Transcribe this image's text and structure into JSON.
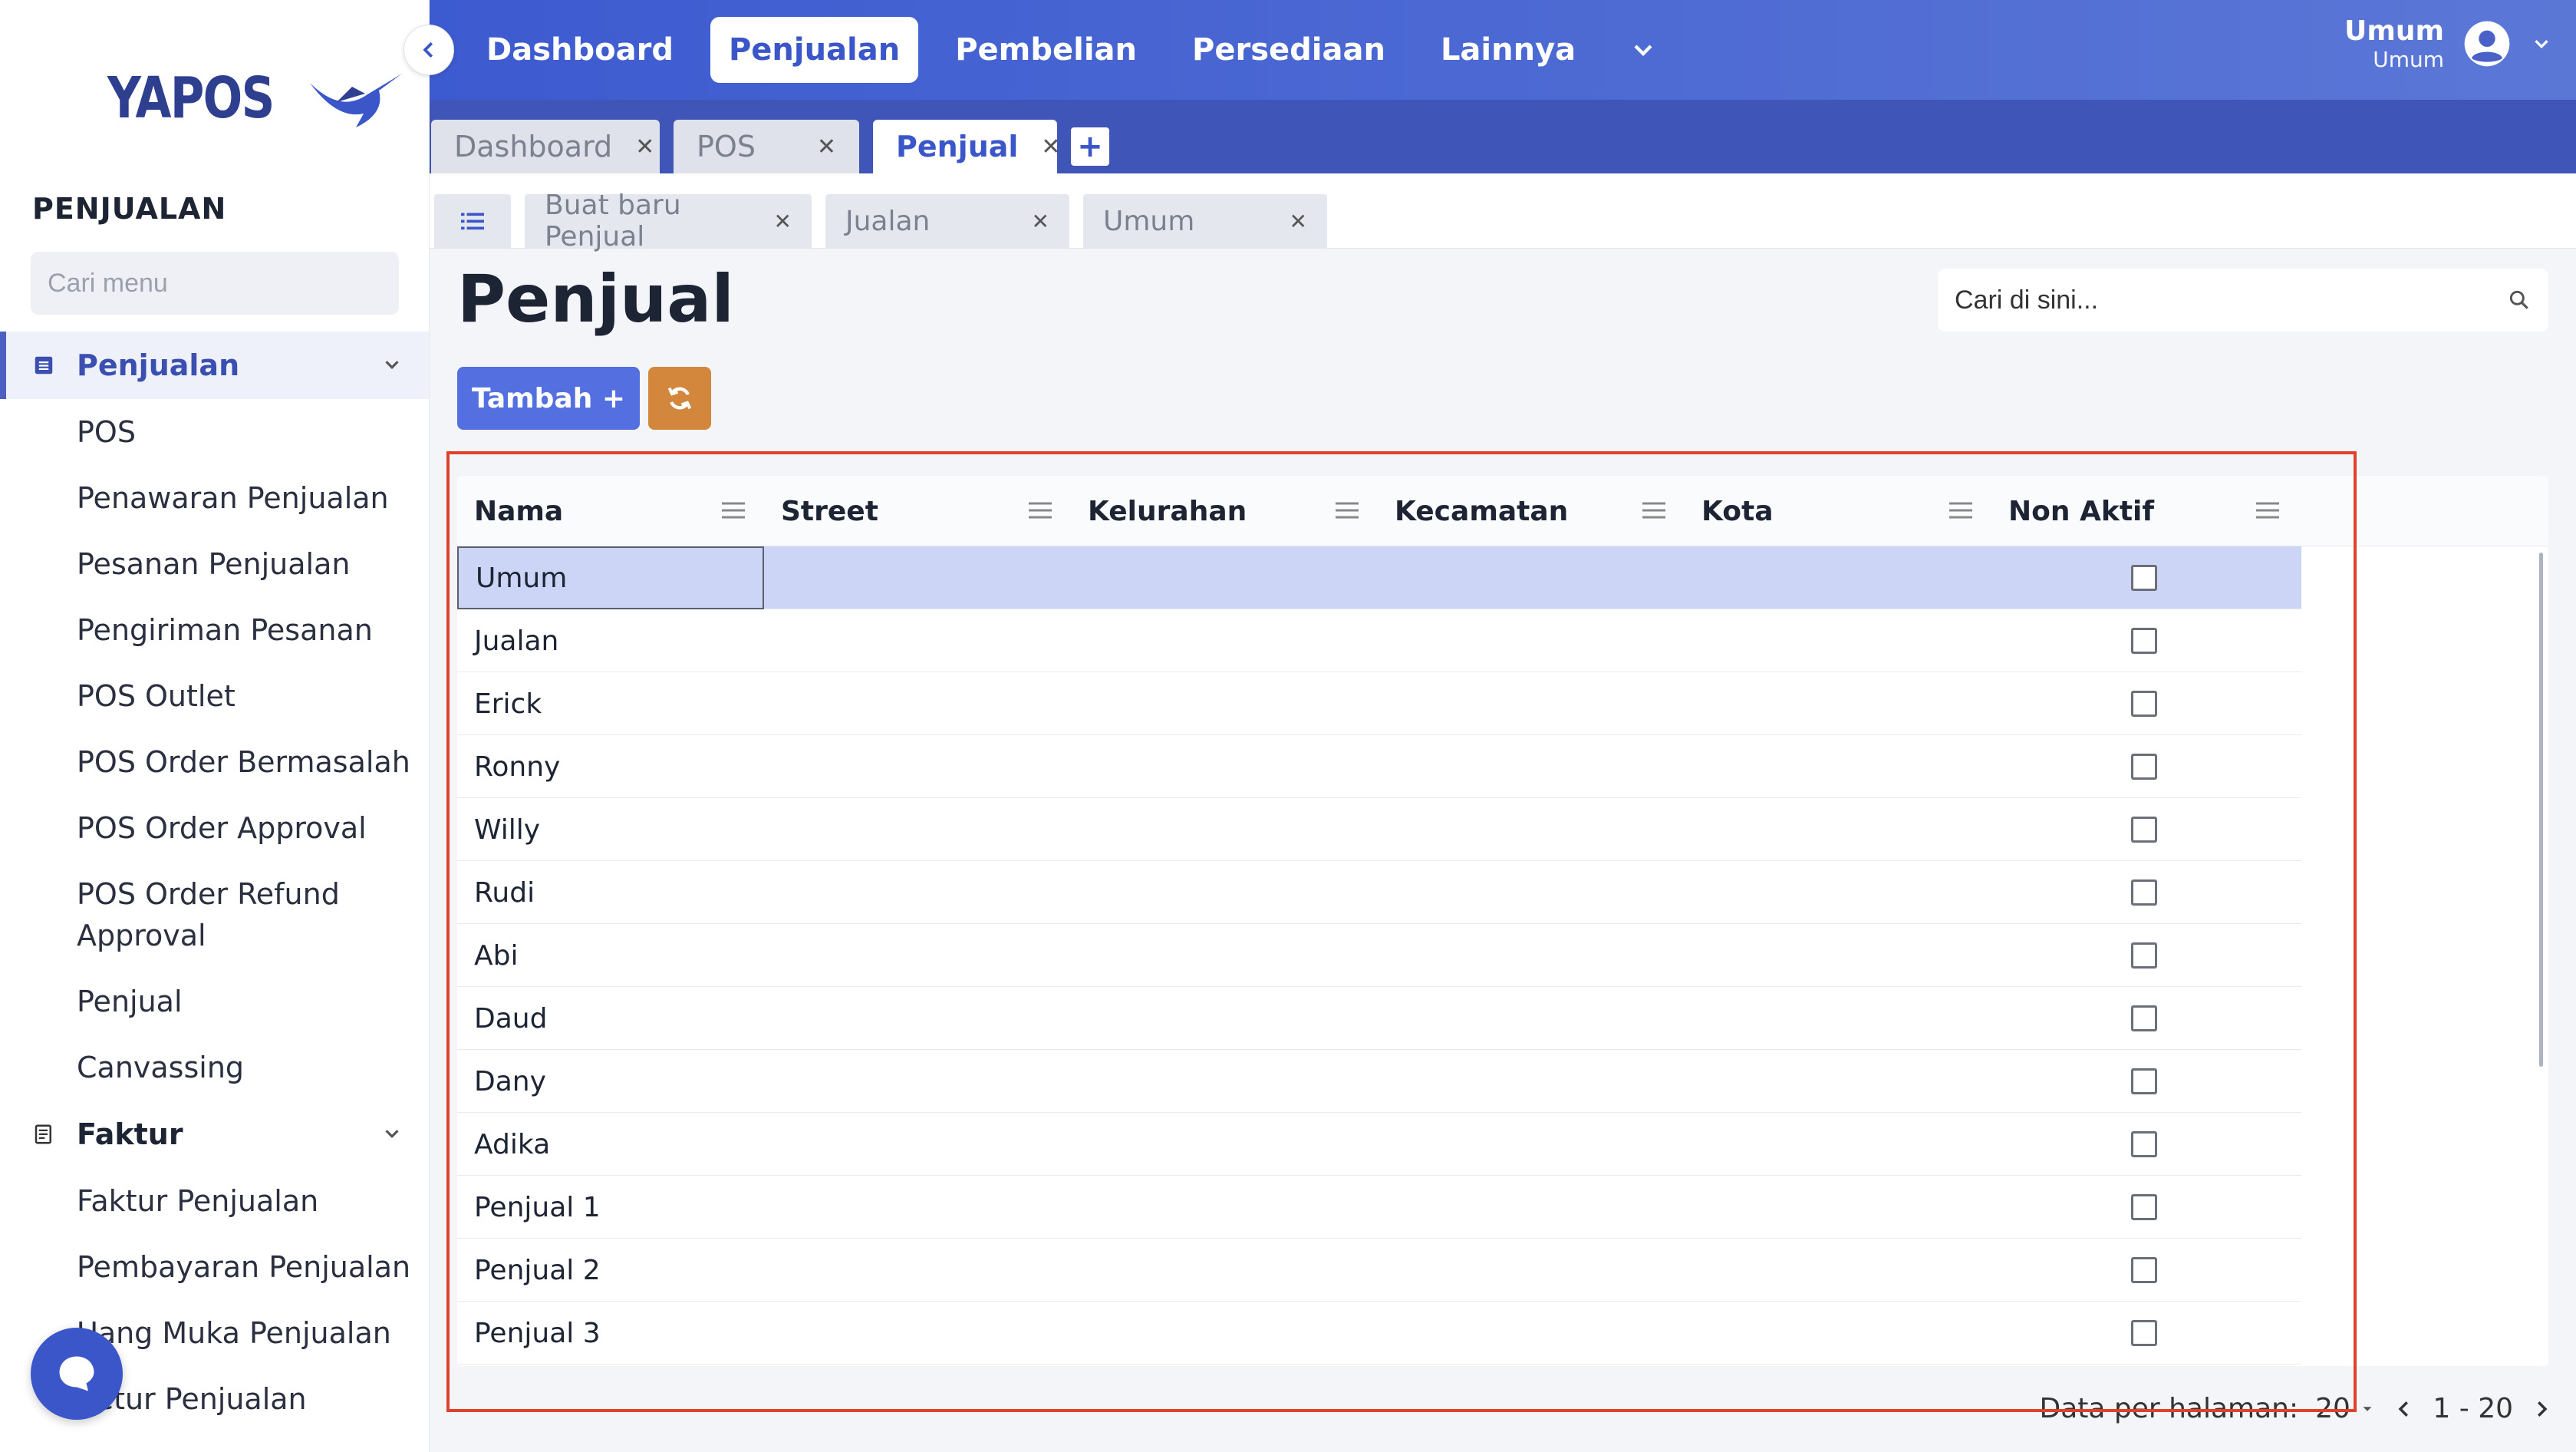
{
  "app": {
    "logo_text": "YAPOS"
  },
  "sidebar": {
    "section_title": "PENJUALAN",
    "search_placeholder": "Cari menu",
    "groups": [
      {
        "label": "Penjualan",
        "icon": "list-icon",
        "items": [
          "POS",
          "Penawaran Penjualan",
          "Pesanan Penjualan",
          "Pengiriman Pesanan",
          "POS Outlet",
          "POS Order Bermasalah",
          "POS Order Approval",
          "POS Order Refund Approval",
          "Penjual",
          "Canvassing"
        ]
      },
      {
        "label": "Faktur",
        "icon": "receipt-icon",
        "items": [
          "Faktur Penjualan",
          "Pembayaran Penjualan",
          "Uang Muka Penjualan",
          "Retur Penjualan"
        ]
      }
    ]
  },
  "topnav": {
    "items": [
      "Dashboard",
      "Penjualan",
      "Pembelian",
      "Persediaan",
      "Lainnya"
    ],
    "active": "Penjualan",
    "user_name": "Umum",
    "user_role": "Umum"
  },
  "tabs": [
    {
      "label": "Dashboard",
      "active": false
    },
    {
      "label": "POS",
      "active": false
    },
    {
      "label": "Penjual",
      "active": true
    }
  ],
  "subtabs": [
    "Buat baru Penjual",
    "Jualan",
    "Umum"
  ],
  "page": {
    "title": "Penjual",
    "search_placeholder": "Cari di sini...",
    "add_button": "Tambah +"
  },
  "grid": {
    "columns": [
      "Nama",
      "Street",
      "Kelurahan",
      "Kecamatan",
      "Kota",
      "Non Aktif"
    ],
    "rows": [
      "Umum",
      "Jualan",
      "Erick",
      "Ronny",
      "Willy",
      "Rudi",
      "Abi",
      "Daud",
      "Dany",
      "Adika",
      "Penjual 1",
      "Penjual 2",
      "Penjual 3"
    ],
    "selected_row": "Umum"
  },
  "pager": {
    "label": "Data per halaman:",
    "per_page": "20",
    "range": "1 - 20"
  },
  "colors": {
    "nav": "#3d5bd0",
    "tab_bar": "#3f56b8",
    "add_button": "#5470e0",
    "refresh_button": "#d3873c",
    "highlight_border": "#e0412a",
    "selected_row": "#ccd5f6"
  }
}
